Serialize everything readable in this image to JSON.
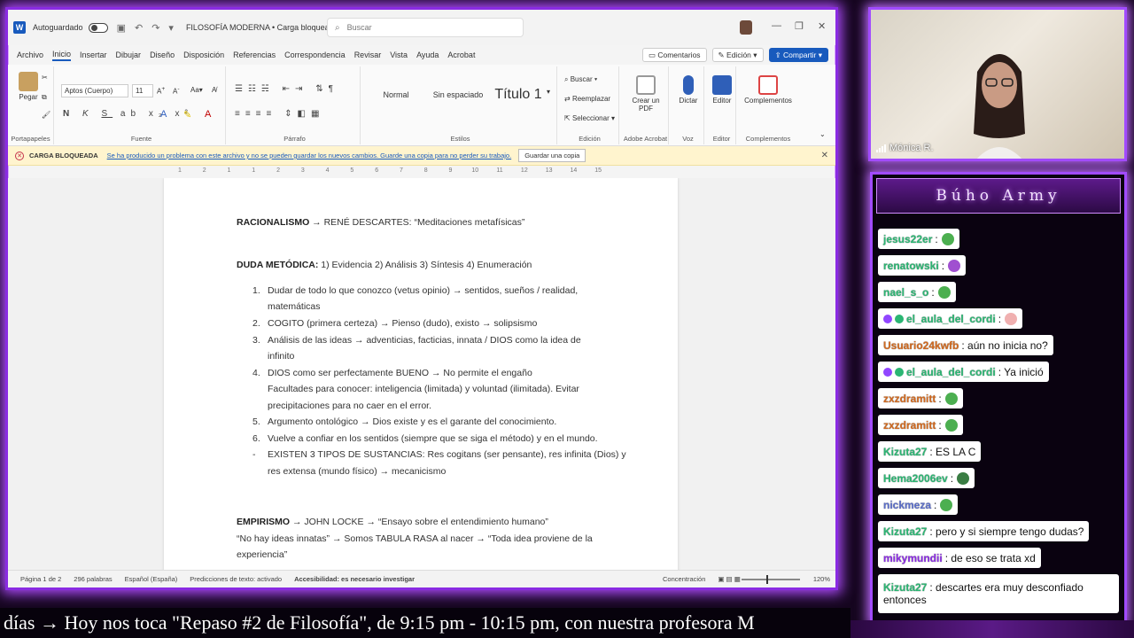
{
  "word": {
    "autosave_label": "Autoguardado",
    "doc_title": "FILOSOFÍA MODERNA • Carga bloqueada",
    "search_placeholder": "Buscar",
    "menu_tabs": [
      "Archivo",
      "Inicio",
      "Insertar",
      "Dibujar",
      "Diseño",
      "Disposición",
      "Referencias",
      "Correspondencia",
      "Revisar",
      "Vista",
      "Ayuda",
      "Acrobat"
    ],
    "comments_label": "Comentarios",
    "edit_label": "Edición",
    "share_label": "Compartir",
    "ribbon": {
      "paste_label": "Pegar",
      "clipboard_group": "Portapapeles",
      "font_name": "Aptos (Cuerpo)",
      "font_size": "11",
      "font_group": "Fuente",
      "paragraph_group": "Párrafo",
      "styles": [
        "Normal",
        "Sin espaciado",
        "Título 1"
      ],
      "styles_group": "Estilos",
      "find_label": "Buscar",
      "replace_label": "Reemplazar",
      "select_label": "Seleccionar",
      "editing_group": "Edición",
      "create_pdf_label": "Crear un PDF",
      "acrobat_group": "Adobe Acrobat",
      "dictate_label": "Dictar",
      "voice_group": "Voz",
      "editor_label": "Editor",
      "editor_group": "Editor",
      "addins_label": "Complementos",
      "addins_group": "Complementos"
    },
    "notification": {
      "title": "CARGA BLOQUEADA",
      "message": "Se ha producido un problema con este archivo y no se pueden guardar los nuevos cambios. Guarde una copia para no perder su trabajo.",
      "button": "Guardar una copia"
    },
    "ruler_marks": [
      "1",
      "2",
      "1",
      "1",
      "2",
      "3",
      "4",
      "5",
      "6",
      "7",
      "8",
      "9",
      "10",
      "11",
      "12",
      "13",
      "14",
      "15"
    ],
    "document": {
      "l1_head": "RACIONALISMO",
      "l1_rest": " → RENÉ DESCARTES: “Meditaciones metafísicas”",
      "l2_head": "DUDA METÓDICA:",
      "l2_rest": " 1) Evidencia 2) Análisis 3) Síntesis 4) Enumeración",
      "items": [
        {
          "num": "1.",
          "lines": [
            "Dudar de todo lo que conozco (vetus opinio) → sentidos, sueños / realidad,",
            "matemáticas"
          ]
        },
        {
          "num": "2.",
          "lines": [
            "COGITO (primera certeza) → Pienso (dudo), existo → solipsismo"
          ]
        },
        {
          "num": "3.",
          "lines": [
            "Análisis de las ideas → adventicias, facticias, innata / DIOS como la idea de",
            "infinito"
          ]
        },
        {
          "num": "4.",
          "lines": [
            "DIOS como ser perfectamente BUENO → No permite el engaño",
            "Facultades para conocer: inteligencia (limitada) y voluntad (ilimitada). Evitar",
            "precipitaciones para no caer en el error."
          ]
        },
        {
          "num": "5.",
          "lines": [
            "Argumento ontológico → Dios existe y es el garante del conocimiento."
          ]
        },
        {
          "num": "6.",
          "lines": [
            "Vuelve a confiar en los sentidos (siempre que se siga el método) y en el mundo."
          ]
        },
        {
          "num": "-",
          "lines": [
            "EXISTEN 3 TIPOS DE SUSTANCIAS: Res cogitans (ser pensante), res infinita (Dios) y",
            "res extensa (mundo físico) → mecanicismo"
          ]
        }
      ],
      "l3_head": "EMPIRISMO",
      "l3_rest": " → JOHN LOCKE → “Ensayo sobre el entendimiento humano”",
      "l4": "“No hay ideas innatas” → Somos TABULA RASA al nacer → “Toda idea proviene de la",
      "l5": "experiencia”"
    },
    "status": {
      "page": "Página 1 de 2",
      "words": "296 palabras",
      "language": "Español (España)",
      "predictions": "Predicciones de texto: activado",
      "accessibility": "Accesibilidad: es necesario investigar",
      "focus": "Concentración",
      "zoom": "120%"
    }
  },
  "webcam": {
    "name": "Mónica R."
  },
  "chat": {
    "title": "Búho Army",
    "messages": [
      {
        "user": "jesus22er",
        "text": "",
        "color": "#2bb673",
        "emote": "#4caf50"
      },
      {
        "user": "renatowski",
        "text": "",
        "color": "#2bb673",
        "emote": "#a050d0"
      },
      {
        "user": "nael_s_o",
        "text": "",
        "color": "#2bb673",
        "emote": "#4caf50"
      },
      {
        "user": "el_aula_del_cordi",
        "text": "",
        "color": "#2bb673",
        "emote": "#f0b0b0",
        "badges": true
      },
      {
        "user": "Usuario24kwfb",
        "text": ": aún no inicia no?",
        "color": "#d2691e"
      },
      {
        "user": "el_aula_del_cordi",
        "text": ": Ya inició",
        "color": "#2bb673",
        "badges": true
      },
      {
        "user": "zxzdramitt",
        "text": "",
        "color": "#d2691e",
        "emote": "#4caf50"
      },
      {
        "user": "zxzdramitt",
        "text": "",
        "color": "#d2691e",
        "emote": "#4caf50"
      },
      {
        "user": "Kizuta27",
        "text": ": ES LA C",
        "color": "#2bb673"
      },
      {
        "user": "Hema2006ev",
        "text": "",
        "color": "#2bb673",
        "emote": "#3a7d44"
      },
      {
        "user": "nickmeza",
        "text": "",
        "color": "#5b6ec9",
        "emote": "#4caf50"
      },
      {
        "user": "Kizuta27",
        "text": ": pero y si siempre tengo dudas?",
        "color": "#2bb673"
      },
      {
        "user": "mikymundii",
        "text": ": de eso se trata xd",
        "color": "#8a2be2"
      },
      {
        "user": "Kizuta27",
        "text": ": descartes era muy desconfiado",
        "text2": "entonces",
        "color": "#2bb673"
      }
    ]
  },
  "ticker": {
    "text": "días  →  Hoy nos toca \"Repaso #2 de Filosofía\", de 9:15 pm - 10:15 pm, con nuestra profesora M"
  }
}
